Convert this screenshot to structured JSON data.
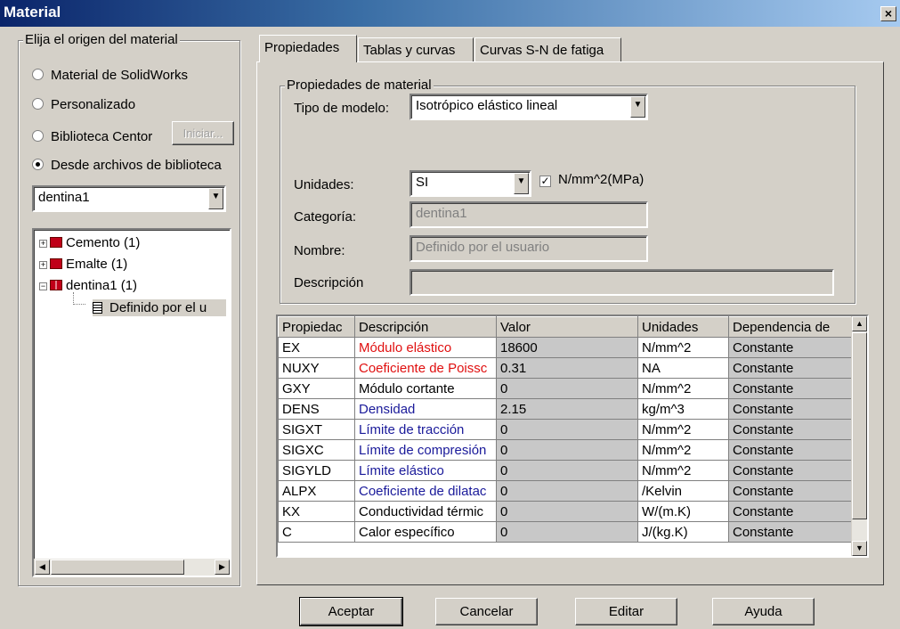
{
  "window": {
    "title": "Material",
    "close_glyph": "×"
  },
  "source_group": {
    "legend": "Elija el origen del material",
    "options": [
      {
        "label": "Material de SolidWorks",
        "checked": false
      },
      {
        "label": "Personalizado",
        "checked": false
      },
      {
        "label": "Biblioteca Centor",
        "checked": false
      },
      {
        "label": "Desde archivos de biblioteca",
        "checked": true
      }
    ],
    "iniciar_label": "Iniciar...",
    "library_select": "dentina1",
    "tree": [
      {
        "label": "Cemento (1)",
        "expander": "+",
        "icon": "book-icon"
      },
      {
        "label": "Emalte (1)",
        "expander": "+",
        "icon": "book-icon"
      },
      {
        "label": "dentina1 (1)",
        "expander": "−",
        "icon": "open-book-icon"
      },
      {
        "label": "Definido por el u",
        "icon": "document-icon"
      }
    ]
  },
  "tabs": [
    {
      "label": "Propiedades",
      "active": true
    },
    {
      "label": "Tablas y curvas",
      "active": false
    },
    {
      "label": "Curvas S-N de fatiga",
      "active": false
    }
  ],
  "properties_group": {
    "legend": "Propiedades de material",
    "model_type_label": "Tipo de modelo:",
    "model_type_value": "Isotrópico elástico lineal",
    "units_label": "Unidades:",
    "units_value": "SI",
    "units_checkbox_label": "N/mm^2(MPa)",
    "units_checkbox_checked": true,
    "category_label": "Categoría:",
    "category_value": "dentina1",
    "name_label": "Nombre:",
    "name_value": "Definido por el usuario",
    "description_label": "Descripción",
    "description_value": ""
  },
  "grid": {
    "columns": [
      "Propiedac",
      "Descripción",
      "Valor",
      "Unidades",
      "Dependencia de"
    ],
    "rows": [
      {
        "prop": "EX",
        "desc": "Módulo elástico",
        "value": "18600",
        "units": "N/mm^2",
        "dep": "Constante",
        "desc_color": "#e01010"
      },
      {
        "prop": "NUXY",
        "desc": "Coeficiente de Poissc",
        "value": "0.31",
        "units": "NA",
        "dep": "Constante",
        "desc_color": "#e01010"
      },
      {
        "prop": "GXY",
        "desc": "Módulo cortante",
        "value": "0",
        "units": "N/mm^2",
        "dep": "Constante",
        "desc_color": "#000000"
      },
      {
        "prop": "DENS",
        "desc": "Densidad",
        "value": "2.15",
        "units": "kg/m^3",
        "dep": "Constante",
        "desc_color": "#1a1a9a"
      },
      {
        "prop": "SIGXT",
        "desc": "Límite de tracción",
        "value": "0",
        "units": "N/mm^2",
        "dep": "Constante",
        "desc_color": "#1a1a9a"
      },
      {
        "prop": "SIGXC",
        "desc": "Límite de compresión",
        "value": "0",
        "units": "N/mm^2",
        "dep": "Constante",
        "desc_color": "#1a1a9a"
      },
      {
        "prop": "SIGYLD",
        "desc": "Límite elástico",
        "value": "0",
        "units": "N/mm^2",
        "dep": "Constante",
        "desc_color": "#1a1a9a"
      },
      {
        "prop": "ALPX",
        "desc": "Coeficiente de dilatac",
        "value": "0",
        "units": "/Kelvin",
        "dep": "Constante",
        "desc_color": "#1a1a9a"
      },
      {
        "prop": "KX",
        "desc": "Conductividad térmic",
        "value": "0",
        "units": "W/(m.K)",
        "dep": "Constante",
        "desc_color": "#000000"
      },
      {
        "prop": "C",
        "desc": "Calor específico",
        "value": "0",
        "units": "J/(kg.K)",
        "dep": "Constante",
        "desc_color": "#000000"
      }
    ]
  },
  "buttons": {
    "accept": "Aceptar",
    "cancel": "Cancelar",
    "edit": "Editar",
    "help": "Ayuda"
  },
  "glyphs": {
    "down": "▼",
    "up": "▲",
    "left": "◀",
    "right": "▶",
    "check": "✓"
  }
}
